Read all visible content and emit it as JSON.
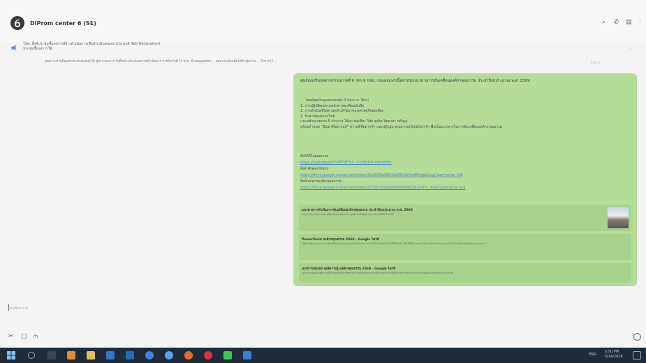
{
  "header": {
    "title": "DIProm center 6 (S1)",
    "caret": "▾",
    "icons": [
      "search-icon",
      "phone-icon",
      "notes-icon",
      "more-icon"
    ],
    "icon_glyphs": [
      "⌕",
      "✆",
      "▤",
      "⋮"
    ]
  },
  "pinned": {
    "line1": "โน้ต: ลิ้งค์ประชุมชี้แจงการมีจ้างดำเนินการเพื่อประเมินตนเอง (Consult Self Declaration)",
    "line2": "ประชุมชี้แจงการใช้",
    "chevron": "⌄"
  },
  "prev_message": {
    "text": "ขอความร่วมมือแจ้งประชาสัมพันธ์ ถึง ผู้ประกอบการ ในพื้นที่ แล้วแจ้งผลการดำเนินการ ภายในวันที่ 15 มี.ค. นี้ ขอบคุณครับ ... สอบถามเพิ่มเติมได้ที่ กลุ่มงาน ... โทร 054 ...",
    "time": "3:22 น."
  },
  "message": {
    "header": "ศูนย์ส่งเสริมอุตสาหกรรมภาคที่ 6 (ศภ.6 กสอ.) ขอเผยแพร่เนื้อหาสรุปแนวทางการขับเคลื่อนองค์กรคุณธรรม ประจำปีงบประมาณ พ.ศ. 2569",
    "lines": [
      "โดยน้อมนำคุณธรรมหลัก 3 ประการ ได้แก่",
      "1. การปฏิบัติตนตามหลักศาสนาที่ตนนับถือ",
      "2. การดำเนินชีวิตตามหลักปรัชญาของเศรษฐกิจพอเพียง",
      "3. รักษาวัฒนธรรมไทย",
      "และหลักคุณธรรม 5 ประการ ได้แก่ พอเพียง วินัย สุจริต จิตอาสา กตัญญู",
      "พร้อมกำหนด \"ปัญหาที่อยากแก้\" ความดีที่อยากทำ และปฏิญญาคุณธรรม(Do&Don't) เพื่อเป็นแนวทางในการขับเคลื่อนองค์กรคุณธรรม"
    ],
    "links": [
      {
        "label": "ลิ้งค์วีดีโอคุณธรรม",
        "url": "https://youtube/pk1nXPE4F7cc--CysqQDK-mamb5fin"
      },
      {
        "label": "ลิ้งค์ Power Point",
        "url": "https://drive.google.com/drive/folders/1LdJS5NuNtfEXuDRKdUHwBWdgbZyqg?usp=drive_link"
      },
      {
        "label": "ลิ้งค์เอกสารองค์กรคุณธรรม",
        "url": "https://drive.google.com/drive/folders/1n79Lfm0XKeWq8cMEWZdCoeUT1_4xdj?usp=drive_link"
      }
    ],
    "cards": [
      {
        "title": "แนวทางการดำเนินการขับเคลื่อนองค์กรคุณธรรม ประจำปีงบประมาณ พ.ศ. 2569",
        "desc": "เอกสารประกอบการขับเคลื่อนองค์กรคุณธรรม ศูนย์ส่งเสริมอุตสาหกรรมภาคที่ 6 ปี 2569"
      },
      {
        "title": "PowerPoint องค์กรคุณธรรม 2569 - Google ไดรฟ์",
        "desc": "ไฟล์นำเสนอแนวทางการขับเคลื่อนองค์กรคุณธรรม ปีงบประมาณ 2569 สำหรับเจ้าหน้าที่ในสังกัด เพื่อใช้เป็นแนวทางในการดำเนินงาน และนำไปปรับใช้ตามบริบทของหน่วยงาน"
      },
      {
        "title": "เอกสารเผยแพร่ องค์ความรู้ องค์กรคุณธรรม 2569 - Google ไดรฟ์",
        "desc": "เอกสารเผยแพร่องค์ความรู้ด้านคุณธรรม จริยธรรม สำหรับบุคลากรและผู้ประกอบการ เพื่อส่งเสริมการดำเนินงานอย่างมีคุณธรรมและความโปร่งใส"
      }
    ]
  },
  "input": {
    "placeholder": "พิมพ์ข้อความ"
  },
  "tools": [
    "attach-icon",
    "sticker-icon",
    "crop-icon",
    "emoji-icon"
  ],
  "tool_glyphs": [
    "✂",
    "□",
    "⫙"
  ],
  "taskbar": {
    "time": "5:50 PM",
    "date": "5/14/2026",
    "lang": "ENG"
  }
}
